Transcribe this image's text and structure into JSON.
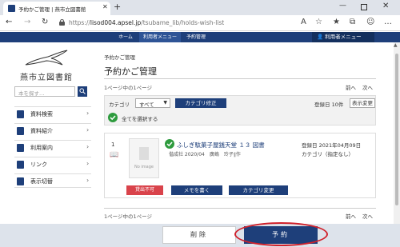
{
  "browser": {
    "tab_title": "予約かご管理 | 燕市立図書館",
    "new_tab": "+",
    "url_host": "lisod004.apsel.jp",
    "url_scheme": "https://",
    "url_path": "/tsubame_lib/holds-wish-list"
  },
  "header": {
    "nav": [
      {
        "label": "ホーム"
      },
      {
        "label": "利用者メニュー"
      },
      {
        "label": "予約管理"
      }
    ],
    "user_menu": "利用者メニュー"
  },
  "sidebar": {
    "logo_text": "燕市立図書館",
    "search_placeholder": "本を探す…",
    "items": [
      {
        "label": "資料検索",
        "icon": "search-book-icon"
      },
      {
        "label": "資料紹介",
        "icon": "book-icon"
      },
      {
        "label": "利用案内",
        "icon": "person-icon"
      },
      {
        "label": "リンク",
        "icon": "link-icon"
      },
      {
        "label": "表示切替",
        "icon": "switch-icon"
      }
    ]
  },
  "main": {
    "breadcrumb": "予約かご管理",
    "title": "予約かご管理",
    "page_count": "1ページ中の1ページ",
    "prev": "前へ",
    "next": "次へ",
    "filter": {
      "category_label": "カテゴリ",
      "category_value": "すべて",
      "category_edit": "カテゴリ修正",
      "reg_count": "登録日 10件",
      "order_btn": "表示変更",
      "select_all": "全てを選択する"
    },
    "item": {
      "number": "1",
      "thumb_text": "No image",
      "title": "ふしぎ駄菓子屋銭天堂 １３ 図書",
      "meta": "偕成社 2020/04　廣嶋　玲子∥作",
      "reg_date": "登録日 2021年04月09日",
      "category": "カテゴリ（指定なし）",
      "unavailable": "貸出不可",
      "memo_btn": "メモを書く",
      "category_change": "カテゴリ変更"
    },
    "page_count_bottom": "1ページ中の1ページ"
  },
  "footer": {
    "delete": "削除",
    "reserve": "予約"
  },
  "colors": {
    "brand": "#1e3f7a",
    "danger": "#d9434b",
    "check": "#2e9b3e",
    "highlight": "#d0202a"
  }
}
